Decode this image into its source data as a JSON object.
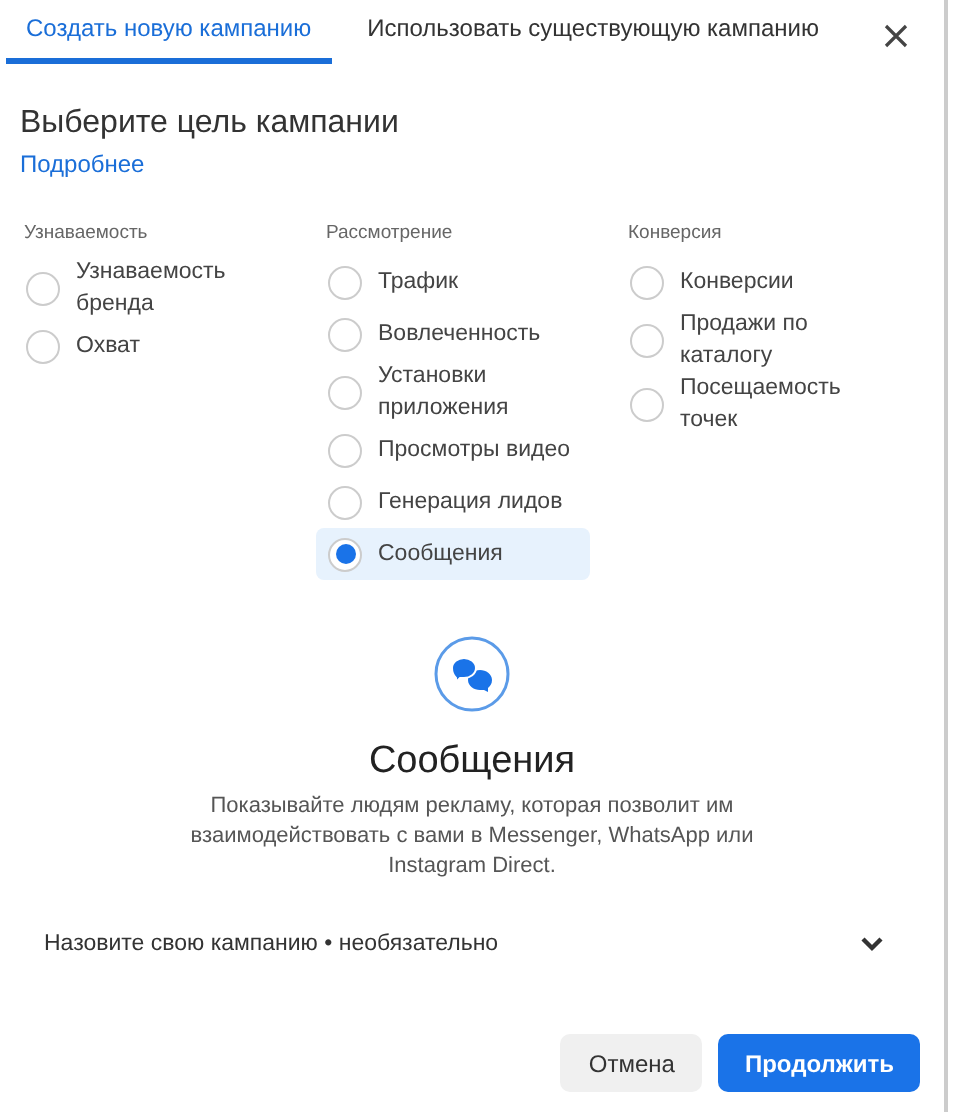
{
  "tabs": [
    {
      "label": "Создать новую кампанию",
      "selected": true
    },
    {
      "label": "Использовать существующую кампанию",
      "selected": false
    }
  ],
  "heading": "Выберите цель кампании",
  "learn_more": "Подробнее",
  "columns": [
    {
      "title": "Узнаваемость",
      "options": [
        {
          "label": "Узнаваемость бренда",
          "selected": false
        },
        {
          "label": "Охват",
          "selected": false
        }
      ]
    },
    {
      "title": "Рассмотрение",
      "options": [
        {
          "label": "Трафик",
          "selected": false
        },
        {
          "label": "Вовлеченность",
          "selected": false
        },
        {
          "label": "Установки приложения",
          "selected": false
        },
        {
          "label": "Просмотры видео",
          "selected": false
        },
        {
          "label": "Генерация лидов",
          "selected": false
        },
        {
          "label": "Сообщения",
          "selected": true
        }
      ]
    },
    {
      "title": "Конверсия",
      "options": [
        {
          "label": "Конверсии",
          "selected": false
        },
        {
          "label": "Продажи по каталогу",
          "selected": false
        },
        {
          "label": "Посещаемость точек",
          "selected": false
        }
      ]
    }
  ],
  "detail": {
    "title": "Сообщения",
    "description": "Показывайте людям рекламу, которая позволит им взаимодействовать с вами в Messenger, WhatsApp или Instagram Direct."
  },
  "name_section": {
    "label": "Назовите свою кампанию • необязательно",
    "expanded": false
  },
  "buttons": {
    "cancel": "Отмена",
    "continue": "Продолжить"
  }
}
